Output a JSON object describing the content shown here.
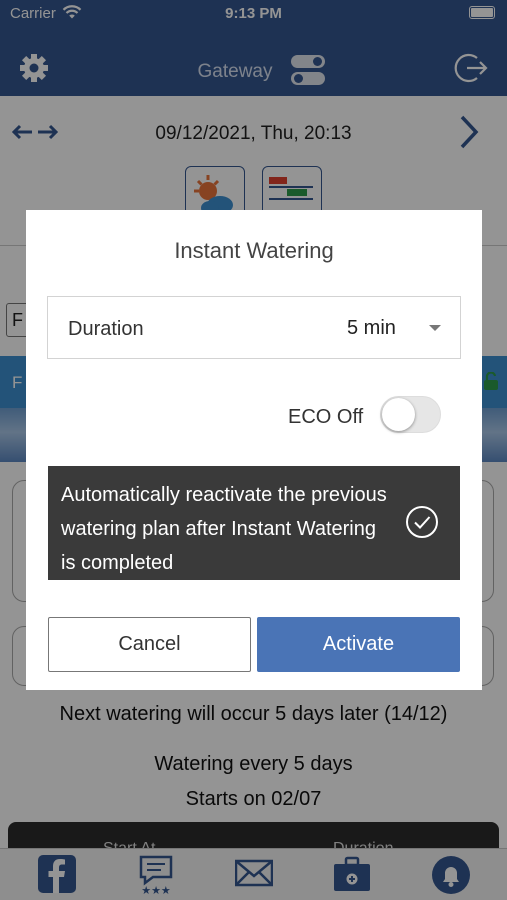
{
  "status_bar": {
    "carrier": "Carrier",
    "time": "9:13 PM"
  },
  "nav": {
    "title": "Gateway"
  },
  "date_bar": {
    "date": "09/12/2021, Thu, 20:13"
  },
  "background": {
    "select_text": "F",
    "row_label": "F",
    "next_watering": "Next watering will occur 5 days later (14/12)",
    "watering_every": "Watering every 5 days",
    "starts_on": "Starts on 02/07",
    "table_headers": [
      "Start At",
      "Duration"
    ]
  },
  "modal": {
    "title": "Instant Watering",
    "duration_label": "Duration",
    "duration_value": "5 min",
    "eco_label": "ECO Off",
    "eco_on": false,
    "reactivate_text": "Automatically reactivate the previous watering plan after Instant Watering is completed",
    "reactivate_checked": true,
    "cancel_label": "Cancel",
    "activate_label": "Activate"
  },
  "colors": {
    "nav_blue": "#35578f",
    "activate_blue": "#4a74b6",
    "dark_panel": "#3a3a3a",
    "accent_blue": "#3d8fd0"
  },
  "tab_bar": {
    "icons": [
      "facebook-icon",
      "feedback-icon",
      "mail-icon",
      "toolbox-icon",
      "notification-bell-icon"
    ]
  }
}
